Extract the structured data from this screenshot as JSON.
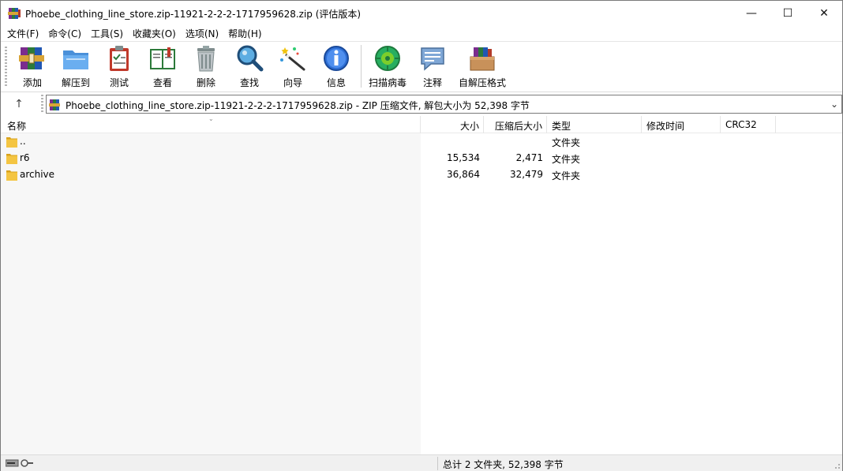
{
  "window": {
    "title": "Phoebe_clothing_line_store.zip-11921-2-2-2-1717959628.zip (评估版本)",
    "controls": {
      "minimize": "—",
      "maximize": "☐",
      "close": "✕"
    }
  },
  "menu": [
    {
      "label": "文件(F)"
    },
    {
      "label": "命令(C)"
    },
    {
      "label": "工具(S)"
    },
    {
      "label": "收藏夹(O)"
    },
    {
      "label": "选项(N)"
    },
    {
      "label": "帮助(H)"
    }
  ],
  "toolbar": {
    "buttons": [
      {
        "label": "添加",
        "icon": "add-archive-icon"
      },
      {
        "label": "解压到",
        "icon": "extract-folder-icon"
      },
      {
        "label": "测试",
        "icon": "test-clipboard-icon"
      },
      {
        "label": "查看",
        "icon": "view-book-icon"
      },
      {
        "label": "删除",
        "icon": "trash-icon"
      },
      {
        "label": "查找",
        "icon": "magnifier-icon"
      },
      {
        "label": "向导",
        "icon": "wizard-wand-icon"
      },
      {
        "label": "信息",
        "icon": "info-icon"
      },
      {
        "label": "扫描病毒",
        "icon": "virus-scan-icon"
      },
      {
        "label": "注释",
        "icon": "comment-icon"
      },
      {
        "label": "自解压格式",
        "icon": "sfx-box-icon"
      }
    ]
  },
  "address": {
    "up_glyph": "↑",
    "path": "Phoebe_clothing_line_store.zip-11921-2-2-2-1717959628.zip - ZIP 压缩文件, 解包大小为 52,398 字节",
    "dropdown_glyph": "⌄"
  },
  "columns": {
    "name": "名称",
    "size": "大小",
    "packed": "压缩后大小",
    "type": "类型",
    "modified": "修改时间",
    "crc": "CRC32"
  },
  "files": [
    {
      "name": "..",
      "size": "",
      "packed": "",
      "type": "文件夹"
    },
    {
      "name": "r6",
      "size": "15,534",
      "packed": "2,471",
      "type": "文件夹"
    },
    {
      "name": "archive",
      "size": "36,864",
      "packed": "32,479",
      "type": "文件夹"
    }
  ],
  "status": {
    "summary": "总计 2 文件夹, 52,398 字节"
  },
  "colors": {
    "folder": "#f4c542",
    "folder_dark": "#d9a21b",
    "name_band": "#f7f7f7",
    "status_bg": "#f0f0f0"
  }
}
